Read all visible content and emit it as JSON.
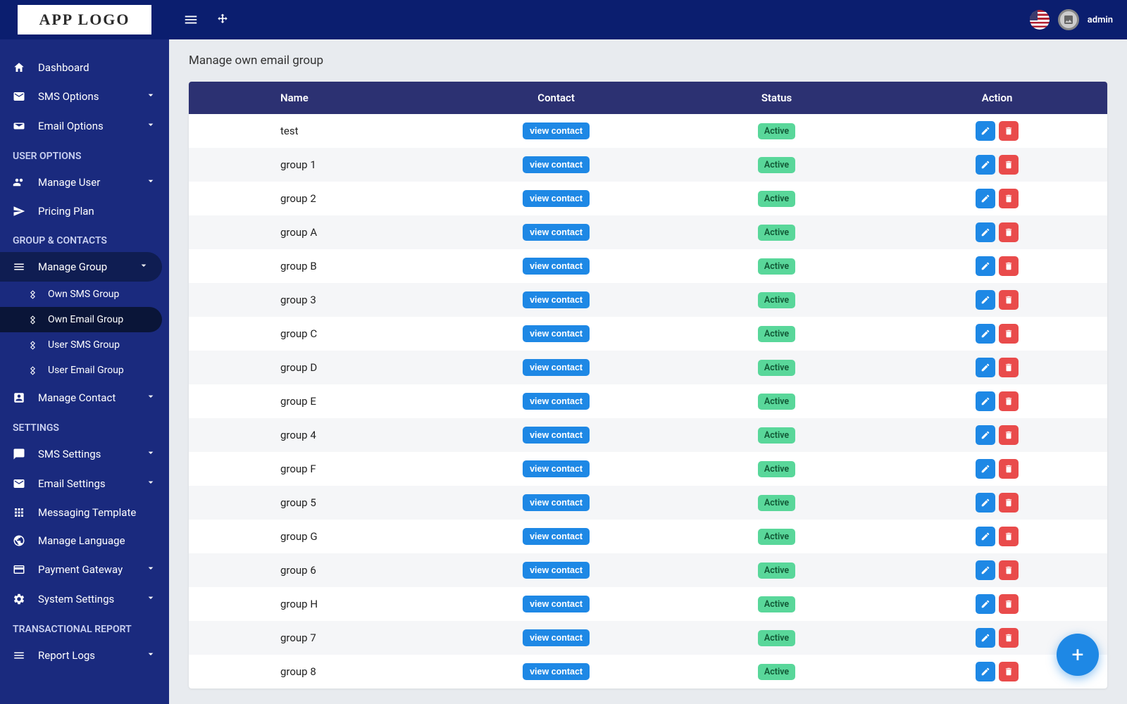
{
  "header": {
    "logo": "APP LOGO",
    "username": "admin"
  },
  "sidebar": {
    "dashboard": "Dashboard",
    "sms_options": "SMS Options",
    "email_options": "Email Options",
    "section_user": "USER OPTIONS",
    "manage_user": "Manage User",
    "pricing_plan": "Pricing Plan",
    "section_group": "GROUP & CONTACTS",
    "manage_group": "Manage Group",
    "sub_own_sms": "Own SMS Group",
    "sub_own_email": "Own Email Group",
    "sub_user_sms": "User SMS Group",
    "sub_user_email": "User Email Group",
    "manage_contact": "Manage Contact",
    "section_settings": "SETTINGS",
    "sms_settings": "SMS Settings",
    "email_settings": "Email Settings",
    "messaging_template": "Messaging Template",
    "manage_language": "Manage Language",
    "payment_gateway": "Payment Gateway",
    "system_settings": "System Settings",
    "section_report": "TRANSACTIONAL REPORT",
    "report_logs": "Report Logs"
  },
  "page": {
    "title": "Manage own email group",
    "columns": {
      "name": "Name",
      "contact": "Contact",
      "status": "Status",
      "action": "Action"
    },
    "view_label": "view contact",
    "status_label": "Active",
    "rows": [
      {
        "name": "test"
      },
      {
        "name": "group 1"
      },
      {
        "name": "group 2"
      },
      {
        "name": "group A"
      },
      {
        "name": "group B"
      },
      {
        "name": "group 3"
      },
      {
        "name": "group C"
      },
      {
        "name": "group D"
      },
      {
        "name": "group E"
      },
      {
        "name": "group 4"
      },
      {
        "name": "group F"
      },
      {
        "name": "group 5"
      },
      {
        "name": "group G"
      },
      {
        "name": "group 6"
      },
      {
        "name": "group H"
      },
      {
        "name": "group 7"
      },
      {
        "name": "group 8"
      }
    ]
  }
}
